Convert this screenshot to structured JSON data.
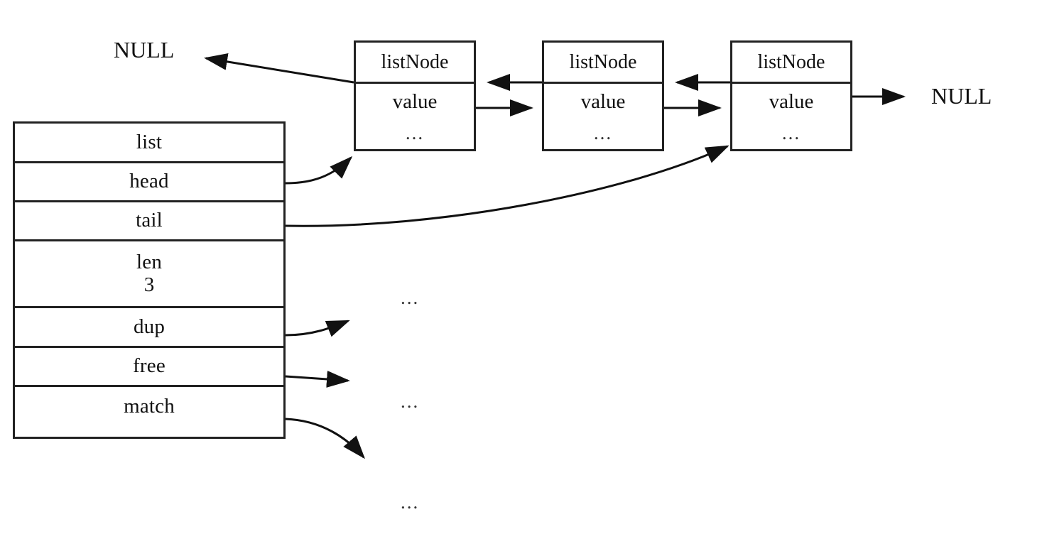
{
  "diagram": {
    "title": "Redis list structure with doubly linked listNode chain",
    "stroke_color": "#222222",
    "background_color": "#ffffff"
  },
  "struct": {
    "name": "list",
    "rows": [
      {
        "label": "list",
        "value": ""
      },
      {
        "label": "head",
        "value": ""
      },
      {
        "label": "tail",
        "value": ""
      },
      {
        "label": "len",
        "value": "3"
      },
      {
        "label": "dup",
        "value": ""
      },
      {
        "label": "free",
        "value": ""
      },
      {
        "label": "match",
        "value": ""
      }
    ]
  },
  "nodes": [
    {
      "title": "listNode",
      "value": "value",
      "dots": "..."
    },
    {
      "title": "listNode",
      "value": "value",
      "dots": "..."
    },
    {
      "title": "listNode",
      "value": "value",
      "dots": "..."
    }
  ],
  "labels": {
    "null_left": "NULL",
    "null_right": "NULL"
  },
  "callback_targets": [
    {
      "name": "dup",
      "dots": "..."
    },
    {
      "name": "free",
      "dots": "..."
    },
    {
      "name": "match",
      "dots": "..."
    }
  ]
}
